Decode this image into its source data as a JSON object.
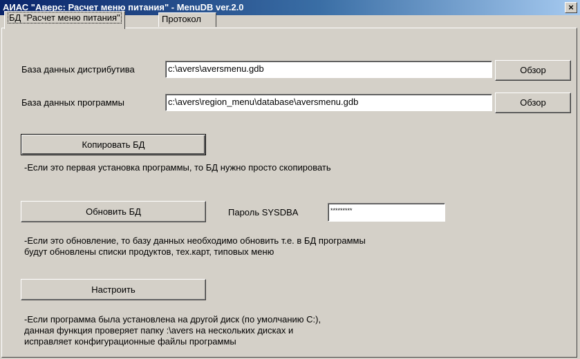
{
  "window": {
    "title": "АИАС \"Аверс: Расчет меню питания\" - MenuDB ver.2.0",
    "close_glyph": "×"
  },
  "tabs": [
    {
      "label": "БД \"Расчет меню питания\"",
      "active": true
    },
    {
      "label": "Протокол",
      "active": false
    }
  ],
  "form": {
    "dist_db_label": "База данных дистрибутива",
    "dist_db_value": "c:\\avers\\aversmenu.gdb",
    "browse_label": "Обзор",
    "prog_db_label": "База данных программы",
    "prog_db_value": "c:\\avers\\region_menu\\database\\aversmenu.gdb",
    "browse2_label": "Обзор",
    "copy_button": "Копировать БД",
    "copy_desc": "-Если это первая установка программы, то БД нужно просто скопировать",
    "update_button": "Обновить БД",
    "password_label": "Пароль SYSDBA",
    "password_value": "*********",
    "update_desc_1": "-Если это обновление, то базу данных необходимо обновить т.е. в БД программы",
    "update_desc_2": "будут обновлены списки продуктов, тех.карт, типовых меню",
    "configure_button": "Настроить",
    "configure_desc_1": "-Если программа была установлена на другой диск (по умолчанию C:),",
    "configure_desc_2": "данная функция проверяет папку :\\avers на нескольких дисках и",
    "configure_desc_3": "исправляет конфигурационные файлы программы"
  },
  "colors": {
    "titlebar_start": "#0a246a",
    "titlebar_end": "#a6caf0",
    "face": "#d4d0c8"
  }
}
